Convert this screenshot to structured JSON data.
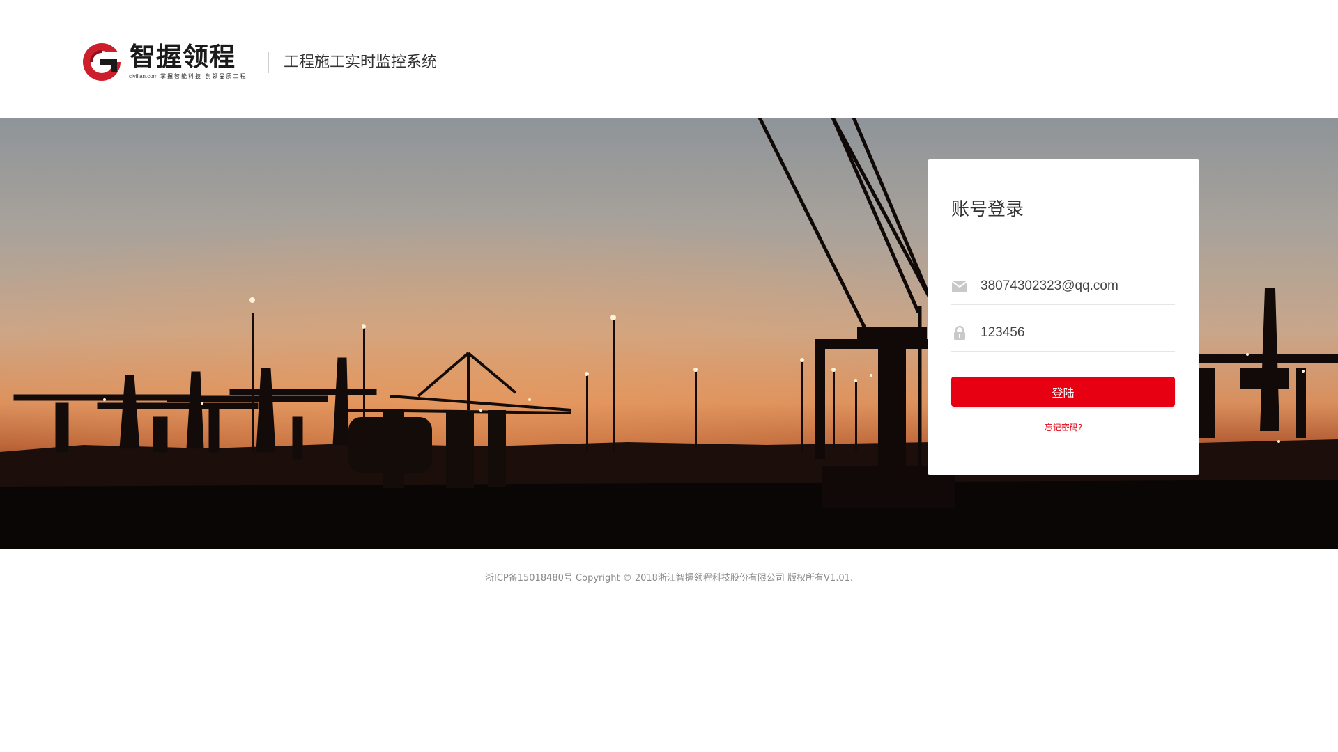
{
  "header": {
    "logo_name": "智握领程",
    "logo_domain": "civillan.com",
    "logo_slogan": "掌握智能科技 创领品质工程",
    "subtitle": "工程施工实时监控系统"
  },
  "login": {
    "title": "账号登录",
    "email_value": "38074302323@qq.com",
    "password_value": "123456",
    "button_label": "登陆",
    "forgot_label": "忘记密码?"
  },
  "footer": {
    "text": "浙ICP备15018480号 Copyright © 2018浙江智握领程科技股份有限公司 版权所有V1.01."
  },
  "colors": {
    "brand_red": "#e60012",
    "text_dark": "#333333",
    "footer_text": "#8a8a8a"
  },
  "icons": {
    "logo": "civillan-g-logo-icon",
    "email": "mail-icon",
    "password": "lock-icon"
  }
}
